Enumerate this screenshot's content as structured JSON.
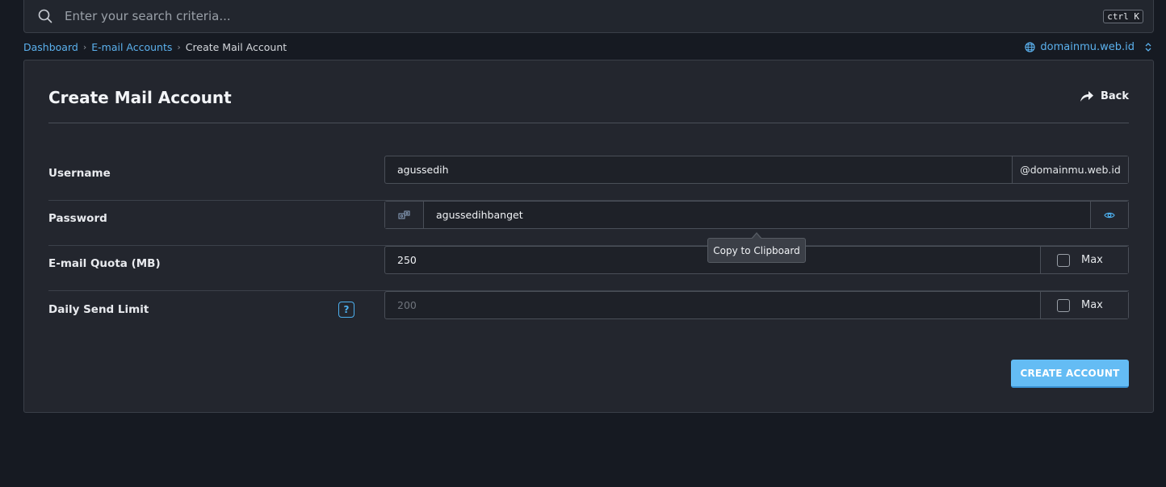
{
  "search": {
    "placeholder": "Enter your search criteria...",
    "shortcut": "ctrl K"
  },
  "breadcrumb": {
    "items": [
      "Dashboard",
      "E-mail Accounts"
    ],
    "current": "Create Mail Account"
  },
  "domain_switch": {
    "label": "domainmu.web.id"
  },
  "card": {
    "title": "Create Mail Account",
    "back_label": "Back"
  },
  "form": {
    "username": {
      "label": "Username",
      "value": "agussedih",
      "suffix": "@domainmu.web.id"
    },
    "password": {
      "label": "Password",
      "value": "agussedihbanget"
    },
    "quota": {
      "label": "E-mail Quota (MB)",
      "value": "250",
      "max_label": "Max"
    },
    "send_limit": {
      "label": "Daily Send Limit",
      "help": "?",
      "placeholder": "200",
      "max_label": "Max"
    }
  },
  "tooltip": {
    "text": "Copy to Clipboard"
  },
  "actions": {
    "create_label": "CREATE ACCOUNT"
  },
  "colors": {
    "accent": "#5bb1ee",
    "button": "#64bcf4",
    "background": "#161a22",
    "card": "#23262e"
  },
  "icons": {
    "search": "search-icon",
    "globe": "globe-icon",
    "back": "share-arrow-icon",
    "generate": "key-generate-icon",
    "eye": "eye-icon",
    "help": "question-icon"
  }
}
